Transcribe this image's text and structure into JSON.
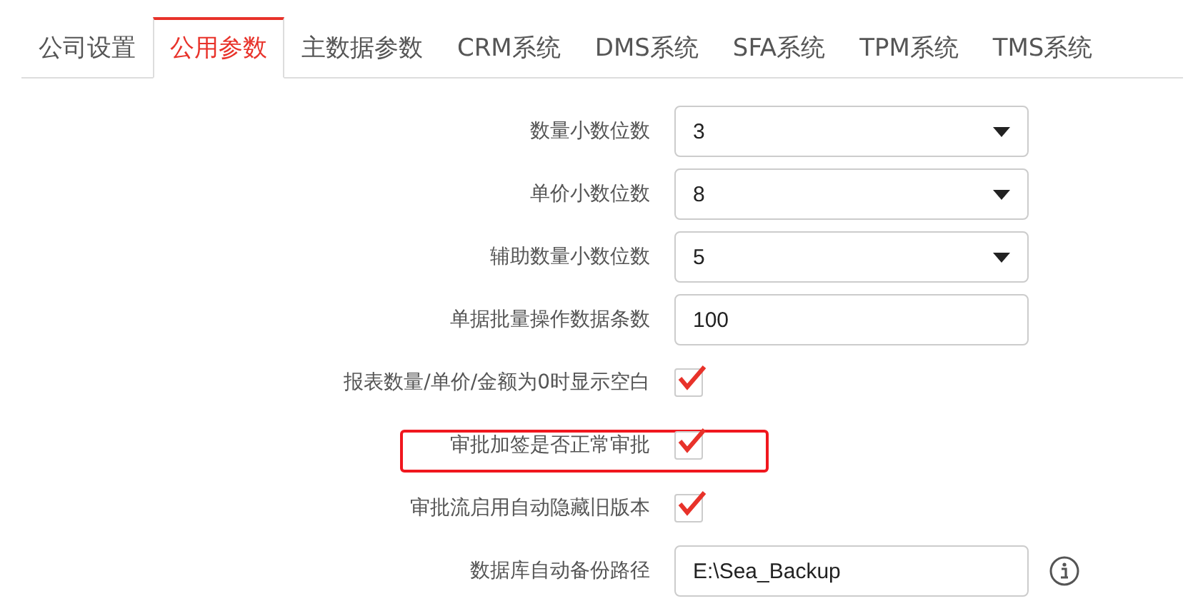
{
  "tabs": [
    {
      "label": "公司设置",
      "selected": false
    },
    {
      "label": "公用参数",
      "selected": true
    },
    {
      "label": "主数据参数",
      "selected": false
    },
    {
      "label": "CRM系统",
      "selected": false
    },
    {
      "label": "DMS系统",
      "selected": false
    },
    {
      "label": "SFA系统",
      "selected": false
    },
    {
      "label": "TPM系统",
      "selected": false
    },
    {
      "label": "TMS系统",
      "selected": false
    }
  ],
  "fields": [
    {
      "kind": "select",
      "label": "数量小数位数",
      "value": "3"
    },
    {
      "kind": "select",
      "label": "单价小数位数",
      "value": "8"
    },
    {
      "kind": "select",
      "label": "辅助数量小数位数",
      "value": "5"
    },
    {
      "kind": "text",
      "label": "单据批量操作数据条数",
      "value": "100"
    },
    {
      "kind": "checkbox",
      "label": "报表数量/单价/金额为0时显示空白",
      "checked": true,
      "highlighted": false
    },
    {
      "kind": "checkbox",
      "label": "审批加签是否正常审批",
      "checked": true,
      "highlighted": true
    },
    {
      "kind": "checkbox",
      "label": "审批流启用自动隐藏旧版本",
      "checked": true,
      "highlighted": false
    },
    {
      "kind": "text",
      "label": "数据库自动备份路径",
      "value": "E:\\Sea_Backup",
      "info": true
    }
  ]
}
